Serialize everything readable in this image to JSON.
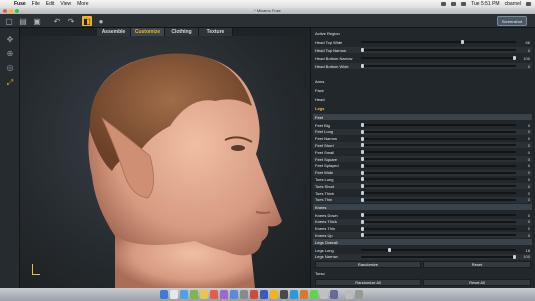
{
  "menubar": {
    "apple": "",
    "items": [
      "Fuse",
      "File",
      "Edit",
      "View",
      "More"
    ],
    "clock": "Tue 5:51 PM",
    "user": "cbarnel"
  },
  "window": {
    "title": "* Mixamo Fuse"
  },
  "toolbar": {
    "screenshot_label": "Screenshot"
  },
  "tabs": [
    {
      "label": "Assemble",
      "active": false
    },
    {
      "label": "Customize",
      "active": true
    },
    {
      "label": "Clothing",
      "active": false
    },
    {
      "label": "Texture",
      "active": false
    }
  ],
  "panel": {
    "active_region_title": "Active Region",
    "head_sliders": [
      {
        "label": "Head Top Wide",
        "value": "66",
        "level": 0.66
      },
      {
        "label": "Head Top Narrow",
        "value": "0",
        "level": 0.0
      },
      {
        "label": "Head Bottom Narrow",
        "value": "100",
        "level": 1.0
      },
      {
        "label": "Head Bottom Wide",
        "value": "0",
        "level": 0.0
      }
    ],
    "regions": [
      "Arms",
      "Face",
      "Head"
    ],
    "legs_title": "Legs",
    "feet_title": "Feet",
    "feet_sliders": [
      {
        "label": "Feet Big",
        "value": "0",
        "level": 0.0
      },
      {
        "label": "Feet Long",
        "value": "0",
        "level": 0.0
      },
      {
        "label": "Feet Narrow",
        "value": "0",
        "level": 0.0
      },
      {
        "label": "Feet Short",
        "value": "0",
        "level": 0.0
      },
      {
        "label": "Feet Small",
        "value": "0",
        "level": 0.0
      },
      {
        "label": "Feet Square",
        "value": "0",
        "level": 0.0
      },
      {
        "label": "Feet Splayed",
        "value": "0",
        "level": 0.0
      },
      {
        "label": "Feet Wide",
        "value": "0",
        "level": 0.0
      },
      {
        "label": "Toes Long",
        "value": "0",
        "level": 0.0
      },
      {
        "label": "Toes Short",
        "value": "0",
        "level": 0.0
      },
      {
        "label": "Toes Thick",
        "value": "0",
        "level": 0.0
      },
      {
        "label": "Toes Thin",
        "value": "0",
        "level": 0.0
      }
    ],
    "knees_title": "Knees",
    "knees_sliders": [
      {
        "label": "Knees Down",
        "value": "0",
        "level": 0.0
      },
      {
        "label": "Knees Thick",
        "value": "0",
        "level": 0.0
      },
      {
        "label": "Knees Thin",
        "value": "0",
        "level": 0.0
      },
      {
        "label": "Knees Up",
        "value": "0",
        "level": 0.0
      }
    ],
    "legs_overall_title": "Legs Overall",
    "legs_sliders": [
      {
        "label": "Legs Long",
        "value": "18",
        "level": 0.18
      },
      {
        "label": "Legs Narrow",
        "value": "100",
        "level": 1.0
      }
    ],
    "randomize_label": "Randomize",
    "reset_label": "Reset",
    "torso_title": "Torso",
    "randomize_all_label": "Randomize All",
    "reset_all_label": "Reset All"
  },
  "colors": {
    "accent": "#f2b41c",
    "panel_bg": "#22272b",
    "viewport_bg": "#2a3035",
    "skin": "#e0a98e",
    "hair": "#8a5a3c"
  }
}
